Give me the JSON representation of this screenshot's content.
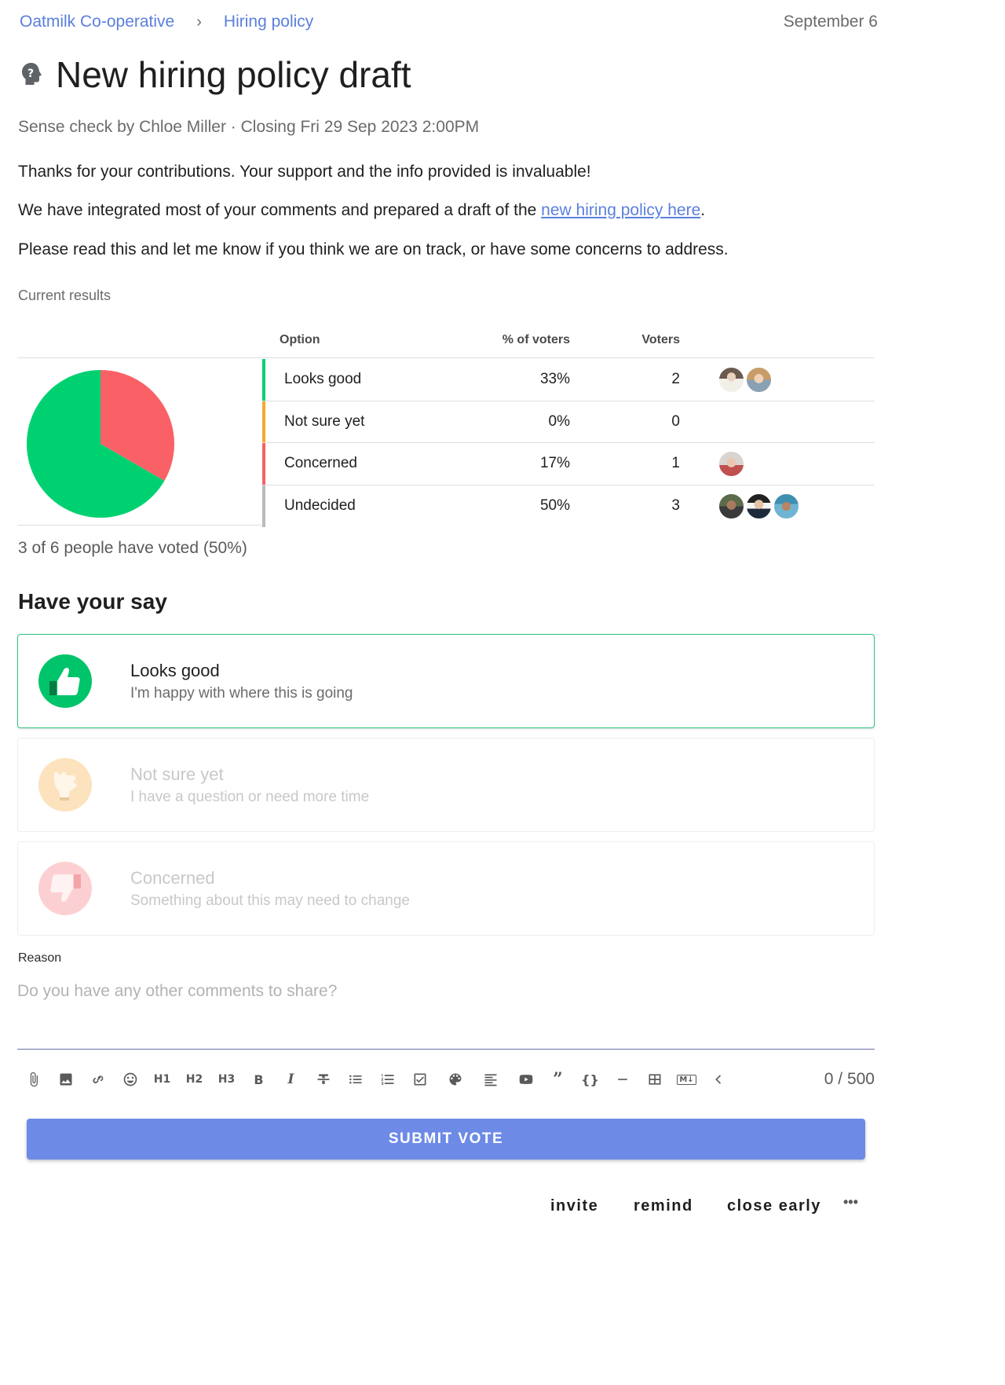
{
  "breadcrumb": {
    "group": "Oatmilk Co-operative",
    "separator": "›",
    "thread": "Hiring policy"
  },
  "date": "September 6",
  "title": "New hiring policy draft",
  "subtitle": "Sense check by Chloe Miller · Closing Fri 29 Sep 2023 2:00PM",
  "body": {
    "p1": "Thanks for your contributions. Your support and the info provided is invaluable!",
    "p2_prefix": "We have integrated most of your comments and prepared a draft of the ",
    "p2_link": "new hiring policy here",
    "p2_suffix": ".",
    "p3": "Please read this and let me know if you think we are on track, or have some concerns to address."
  },
  "results": {
    "label": "Current results",
    "headers": {
      "option": "Option",
      "percent": "% of voters",
      "voters": "Voters"
    },
    "rows": [
      {
        "option": "Looks good",
        "percent": "33%",
        "voters": "2",
        "color": "#00d170"
      },
      {
        "option": "Not sure yet",
        "percent": "0%",
        "voters": "0",
        "color": "#f6a82f"
      },
      {
        "option": "Concerned",
        "percent": "17%",
        "voters": "1",
        "color": "#f96166"
      },
      {
        "option": "Undecided",
        "percent": "50%",
        "voters": "3",
        "color": "#bbbbbb"
      }
    ],
    "voted_summary": "3 of 6 people have voted (50%)"
  },
  "chart_data": {
    "type": "pie",
    "categories": [
      "Looks good",
      "Concerned"
    ],
    "values": [
      2,
      1
    ],
    "colors": [
      "#00d170",
      "#f96166"
    ]
  },
  "have_your_say": {
    "heading": "Have your say",
    "options": [
      {
        "title": "Looks good",
        "subtitle": "I'm happy with where this is going",
        "color": "#00c46a",
        "icon": "thumbs-up-icon"
      },
      {
        "title": "Not sure yet",
        "subtitle": "I have a question or need more time",
        "color": "#f6a82f",
        "icon": "raised-hand-icon"
      },
      {
        "title": "Concerned",
        "subtitle": "Something about this may need to change",
        "color": "#f96166",
        "icon": "thumbs-down-icon"
      }
    ]
  },
  "reason": {
    "label": "Reason",
    "placeholder": "Do you have any other comments to share?",
    "counter": "0 / 500"
  },
  "toolbar": {
    "h1": "H1",
    "h2": "H2",
    "h3": "H3",
    "bold": "B",
    "italic": "I",
    "quote": "”",
    "code": "{}",
    "md": "M↓"
  },
  "submit_label": "SUBMIT VOTE",
  "actions": {
    "invite": "invite",
    "remind": "remind",
    "close_early": "close early",
    "more": "•••"
  }
}
